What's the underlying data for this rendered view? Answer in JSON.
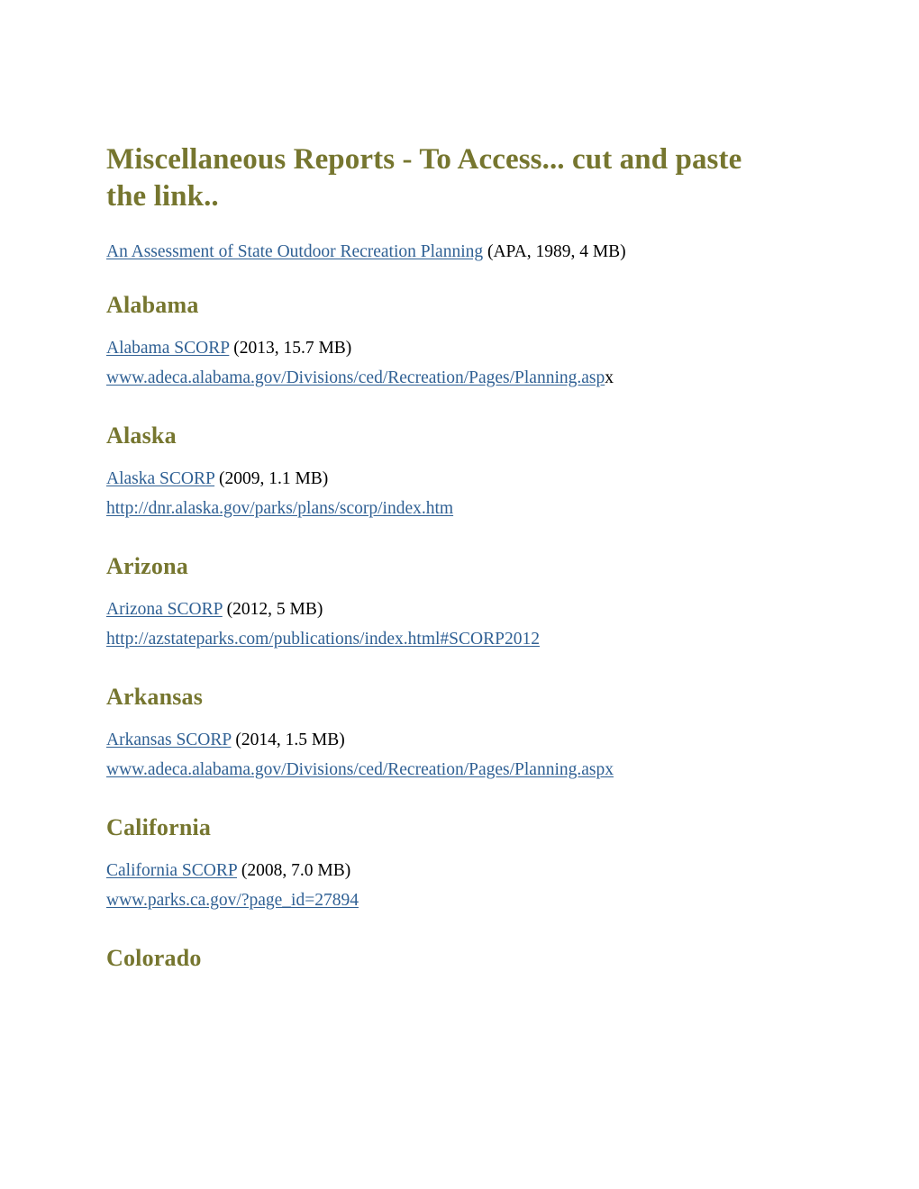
{
  "document": {
    "title_line_1": "Miscellaneous Reports - To Access... cut and paste",
    "title_line_2": "the link..",
    "title_full": "Miscellaneous Reports - To Access... cut and paste the link..",
    "colors": {
      "heading": "#76762f",
      "link": "#2f6094",
      "body_text": "#000000",
      "background": "#ffffff"
    }
  },
  "intro": {
    "link_text": "An Assessment of State Outdoor Recreation Planning",
    "meta_text": " (APA, 1989, 4 MB)"
  },
  "sections": [
    {
      "heading": "Alabama",
      "report_link": "Alabama SCORP",
      "report_meta": " (2013, 15.7 MB)",
      "url_link": "www.adeca.alabama.gov/Divisions/ced/Recreation/Pages/Planning.asp",
      "url_trailing": "x"
    },
    {
      "heading": "Alaska",
      "report_link": "Alaska SCORP",
      "report_meta": " (2009, 1.1 MB)",
      "url_link": "http://dnr.alaska.gov/parks/plans/scorp/index.htm",
      "url_trailing": ""
    },
    {
      "heading": "Arizona",
      "report_link": "Arizona SCORP",
      "report_meta": " (2012, 5 MB)",
      "url_link": "http://azstateparks.com/publications/index.html#SCORP2012",
      "url_trailing": ""
    },
    {
      "heading": "Arkansas",
      "report_link": "Arkansas SCORP",
      "report_meta": " (2014, 1.5 MB)",
      "url_link": "www.adeca.alabama.gov/Divisions/ced/Recreation/Pages/Planning.aspx",
      "url_trailing": ""
    },
    {
      "heading": "California",
      "report_link": "California SCORP",
      "report_meta": " (2008, 7.0 MB)",
      "url_link": "www.parks.ca.gov/?page_id=27894",
      "url_trailing": ""
    },
    {
      "heading": "Colorado",
      "report_link": "",
      "report_meta": "",
      "url_link": "",
      "url_trailing": ""
    }
  ]
}
